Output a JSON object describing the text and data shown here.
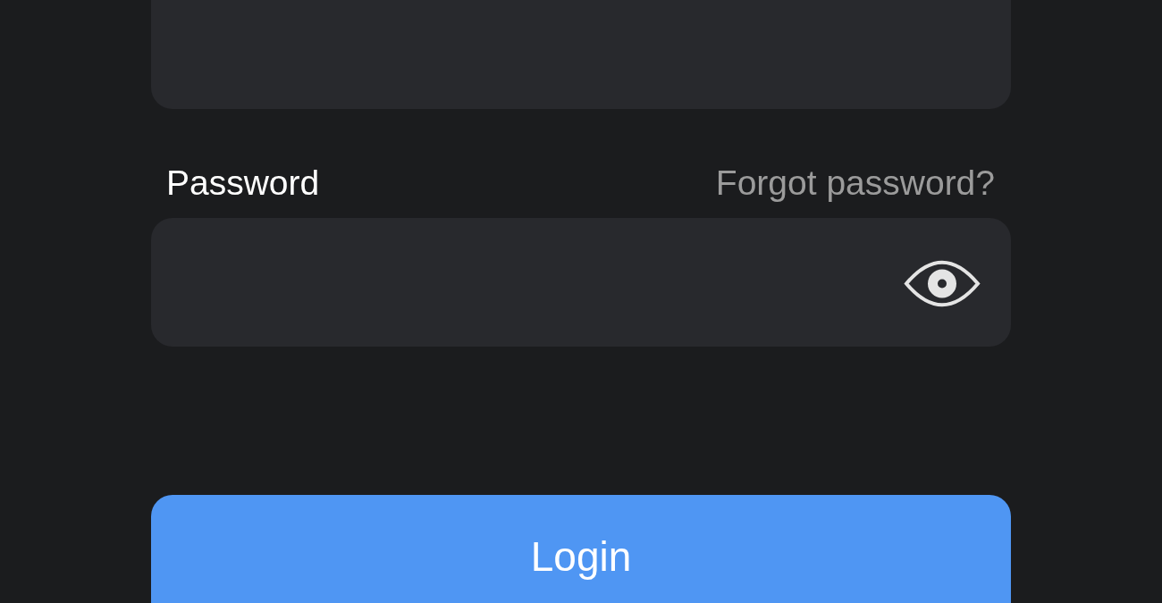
{
  "fields": [
    {
      "kind": "text"
    },
    {
      "kind": "password",
      "label": "Password",
      "link": "Forgot password?"
    }
  ],
  "login_button": {
    "label": "Login"
  }
}
